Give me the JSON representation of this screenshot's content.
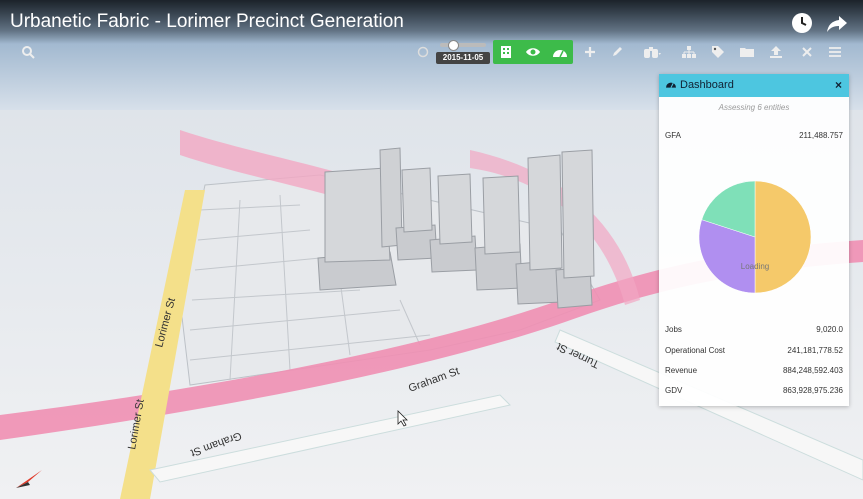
{
  "window": {
    "title": "Urbanetic Fabric - Lorimer Precinct Generation"
  },
  "toolbar": {
    "date": "2015-11-05",
    "icons": [
      "search-icon",
      "slider-icon",
      "building-icon",
      "eye-icon",
      "dashboard-icon",
      "plus-icon",
      "pencil-icon",
      "binoculars-icon",
      "hierarchy-icon",
      "tag-icon",
      "folder-icon",
      "upload-icon",
      "close-icon",
      "menu-icon"
    ]
  },
  "top_icons": [
    "clock-icon",
    "share-icon"
  ],
  "dashboard": {
    "title": "Dashboard",
    "close": "×",
    "subtitle": "Assessing 6 entities",
    "gfa": {
      "label": "GFA",
      "value": "211,488.757"
    },
    "pie": {
      "loading": "Loading",
      "slices": [
        {
          "value": 0.5,
          "color": "#f5c96a"
        },
        {
          "value": 0.3,
          "color": "#b08ff0"
        },
        {
          "value": 0.2,
          "color": "#7fe0b8"
        }
      ]
    },
    "metrics": [
      {
        "label": "Jobs",
        "value": "9,020.0"
      },
      {
        "label": "Operational Cost",
        "value": "241,181,778.52"
      },
      {
        "label": "Revenue",
        "value": "884,248,592.403"
      },
      {
        "label": "GDV",
        "value": "863,928,975.236"
      }
    ]
  },
  "map": {
    "streets": [
      "Lorimer St",
      "Lorimer St",
      "Graham St",
      "Graham St",
      "Turner St"
    ]
  },
  "colors": {
    "accent": "#4dc6e0",
    "toolbar_green": "#3dbb4a",
    "road_pink": "#ef8fb3",
    "road_yellow": "#f4e08a"
  }
}
